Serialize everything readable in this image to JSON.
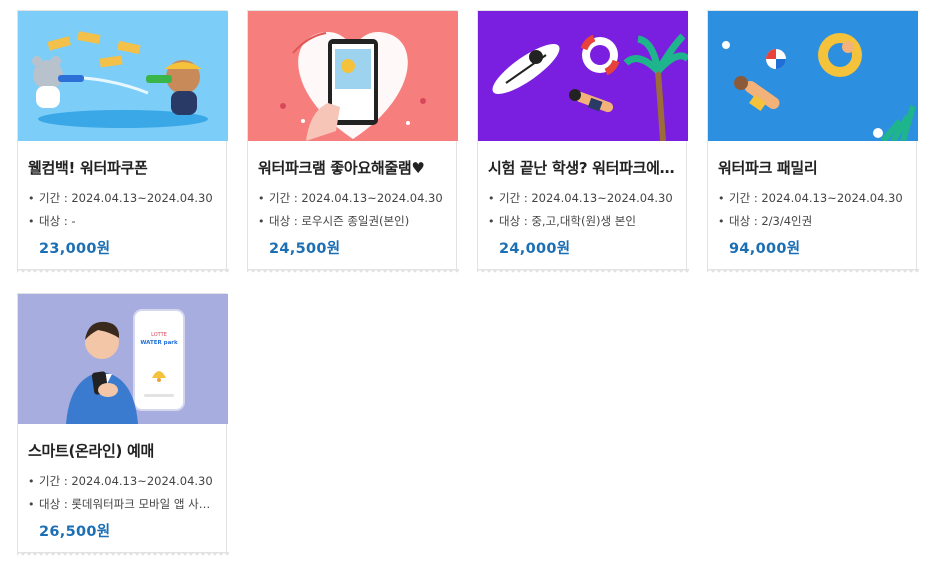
{
  "cards": [
    {
      "title": "웰컴백! 워터파쿠폰",
      "period": "기간 : 2024.04.13~2024.04.30",
      "target": "대상 : -",
      "price": "23,000원",
      "bg": "#7ccdf7"
    },
    {
      "title": "워터파크램 좋아요해줄램♥",
      "period": "기간 : 2024.04.13~2024.04.30",
      "target": "대상 : 로우시즌 종일권(본인)",
      "price": "24,500원",
      "bg": "#f67f7e"
    },
    {
      "title": "시험 끝난 학생? 워터파크에서 놀자",
      "period": "기간 : 2024.04.13~2024.04.30",
      "target": "대상 : 중,고,대학(원)생 본인",
      "price": "24,000원",
      "bg": "#7a1ee0"
    },
    {
      "title": "워터파크 패밀리",
      "period": "기간 : 2024.04.13~2024.04.30",
      "target": "대상 : 2/3/4인권",
      "price": "94,000원",
      "bg": "#2c8fe0"
    },
    {
      "title": "스마트(온라인) 예매",
      "period": "기간 : 2024.04.13~2024.04.30",
      "target": "대상 : 롯데워터파크 모바일 앱 사용자",
      "price": "26,500원",
      "bg": "#a7addf"
    }
  ],
  "phone_logo": {
    "line1": "LOTTE",
    "line2": "WATER park"
  }
}
